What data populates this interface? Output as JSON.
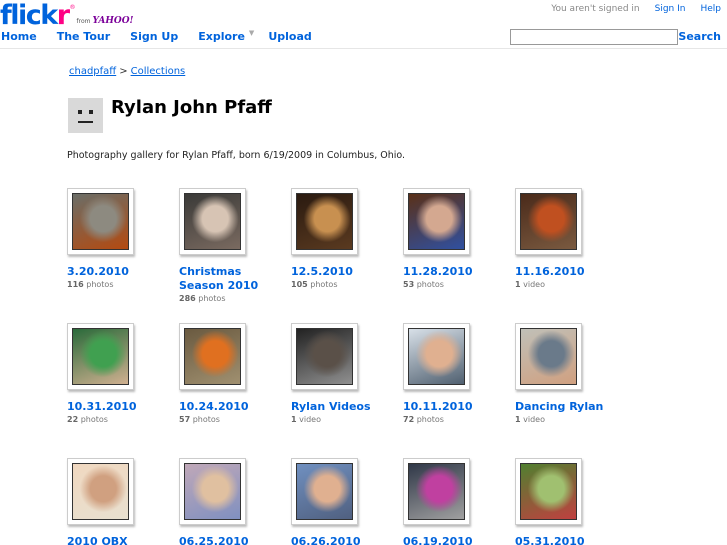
{
  "header": {
    "logo_text_1": "flick",
    "logo_text_2": "r",
    "logo_from": "from",
    "logo_yahoo": "YAHOO!",
    "status": "You aren't signed in",
    "sign_in": "Sign In",
    "help": "Help",
    "nav": [
      "Home",
      "The Tour",
      "Sign Up",
      "Explore",
      "Upload"
    ],
    "search_label": "Search",
    "search_value": ""
  },
  "breadcrumb": {
    "user": "chadpfaff",
    "separator": ">",
    "section": "Collections"
  },
  "title": "Rylan John Pfaff",
  "description": "Photography gallery for Rylan Pfaff, born 6/19/2009 in Columbus, Ohio.",
  "sets": [
    {
      "title": "3.20.2010",
      "count": "116",
      "unit": "photos",
      "colors": [
        "#6a6e68",
        "#8d8a80",
        "#b44a10"
      ]
    },
    {
      "title": "Christmas Season 2010",
      "count": "286",
      "unit": "photos",
      "colors": [
        "#3a3a38",
        "#d7c4b4",
        "#7a6a60"
      ]
    },
    {
      "title": "12.5.2010",
      "count": "105",
      "unit": "photos",
      "colors": [
        "#2a1a10",
        "#c89050",
        "#5a3a20"
      ]
    },
    {
      "title": "11.28.2010",
      "count": "53",
      "unit": "photos",
      "colors": [
        "#5a3018",
        "#d4a890",
        "#3050a0"
      ]
    },
    {
      "title": "11.16.2010",
      "count": "1",
      "unit": "video",
      "colors": [
        "#4a2a1a",
        "#c05020",
        "#7a5a40"
      ]
    },
    {
      "title": "10.31.2010",
      "count": "22",
      "unit": "photos",
      "colors": [
        "#2a6a3a",
        "#40a050",
        "#d0b090"
      ]
    },
    {
      "title": "10.24.2010",
      "count": "57",
      "unit": "photos",
      "colors": [
        "#6a5a40",
        "#e07020",
        "#a09070"
      ]
    },
    {
      "title": "Rylan Videos",
      "count": "1",
      "unit": "video",
      "colors": [
        "#222222",
        "#5a5048",
        "#909090"
      ]
    },
    {
      "title": "10.11.2010",
      "count": "72",
      "unit": "photos",
      "colors": [
        "#d8e0e8",
        "#e0b090",
        "#506070"
      ]
    },
    {
      "title": "Dancing Rylan",
      "count": "1",
      "unit": "video",
      "colors": [
        "#c0c0b8",
        "#6a7a8a",
        "#d0a080"
      ]
    },
    {
      "title": "2010 OBX",
      "count": "",
      "unit": "",
      "colors": [
        "#f0d8c0",
        "#d0a080",
        "#e8e0d0"
      ]
    },
    {
      "title": "06.25.2010",
      "count": "",
      "unit": "",
      "colors": [
        "#c0a8b8",
        "#e0c0a0",
        "#8090c0"
      ]
    },
    {
      "title": "06.26.2010",
      "count": "",
      "unit": "",
      "colors": [
        "#7090c0",
        "#e0b090",
        "#506080"
      ]
    },
    {
      "title": "06.19.2010",
      "count": "",
      "unit": "",
      "colors": [
        "#303848",
        "#c040a0",
        "#a0a0a0"
      ]
    },
    {
      "title": "05.31.2010",
      "count": "",
      "unit": "",
      "colors": [
        "#508030",
        "#a0c070",
        "#c04040"
      ]
    }
  ]
}
